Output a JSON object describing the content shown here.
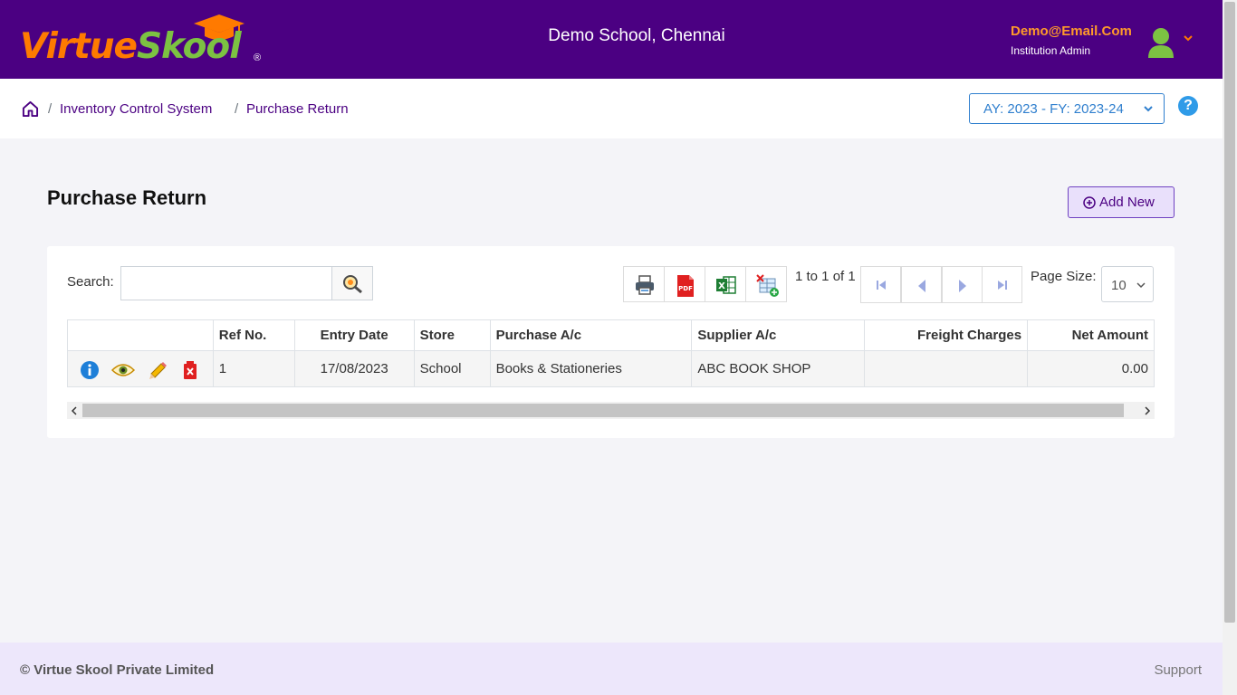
{
  "header": {
    "logo_text_part1": "Virtue",
    "logo_text_part2": "Skool",
    "logo_reg": "®",
    "school_name": "Demo School, Chennai",
    "user_email": "Demo@Email.Com",
    "user_role": "Institution Admin"
  },
  "breadcrumb": {
    "items": [
      "Inventory Control System",
      "Purchase Return"
    ],
    "separator": "/"
  },
  "academic_year": {
    "selected": "AY: 2023 - FY: 2023-24"
  },
  "help_label": "?",
  "page": {
    "title": "Purchase Return",
    "add_new_label": "Add New"
  },
  "toolbar": {
    "search_label": "Search:",
    "search_value": "",
    "pager_text": "1 to 1 of 1",
    "page_size_label": "Page Size:",
    "page_size_value": "10"
  },
  "table": {
    "columns": [
      "",
      "Ref No.",
      "Entry Date",
      "Store",
      "Purchase A/c",
      "Supplier A/c",
      "Freight Charges",
      "Net Amount"
    ],
    "rows": [
      {
        "ref_no": "1",
        "entry_date": "17/08/2023",
        "store": "School",
        "purchase_ac": "Books & Stationeries",
        "supplier_ac": "ABC BOOK SHOP",
        "freight_charges": "",
        "net_amount": "0.00"
      }
    ]
  },
  "footer": {
    "copyright": "© Virtue Skool Private Limited",
    "support": "Support"
  },
  "colors": {
    "header_bg": "#4b0082",
    "accent_orange": "#ff7a00",
    "accent_green": "#7cc242",
    "link_blue": "#2f7fce",
    "footer_bg": "#ede7fb"
  }
}
